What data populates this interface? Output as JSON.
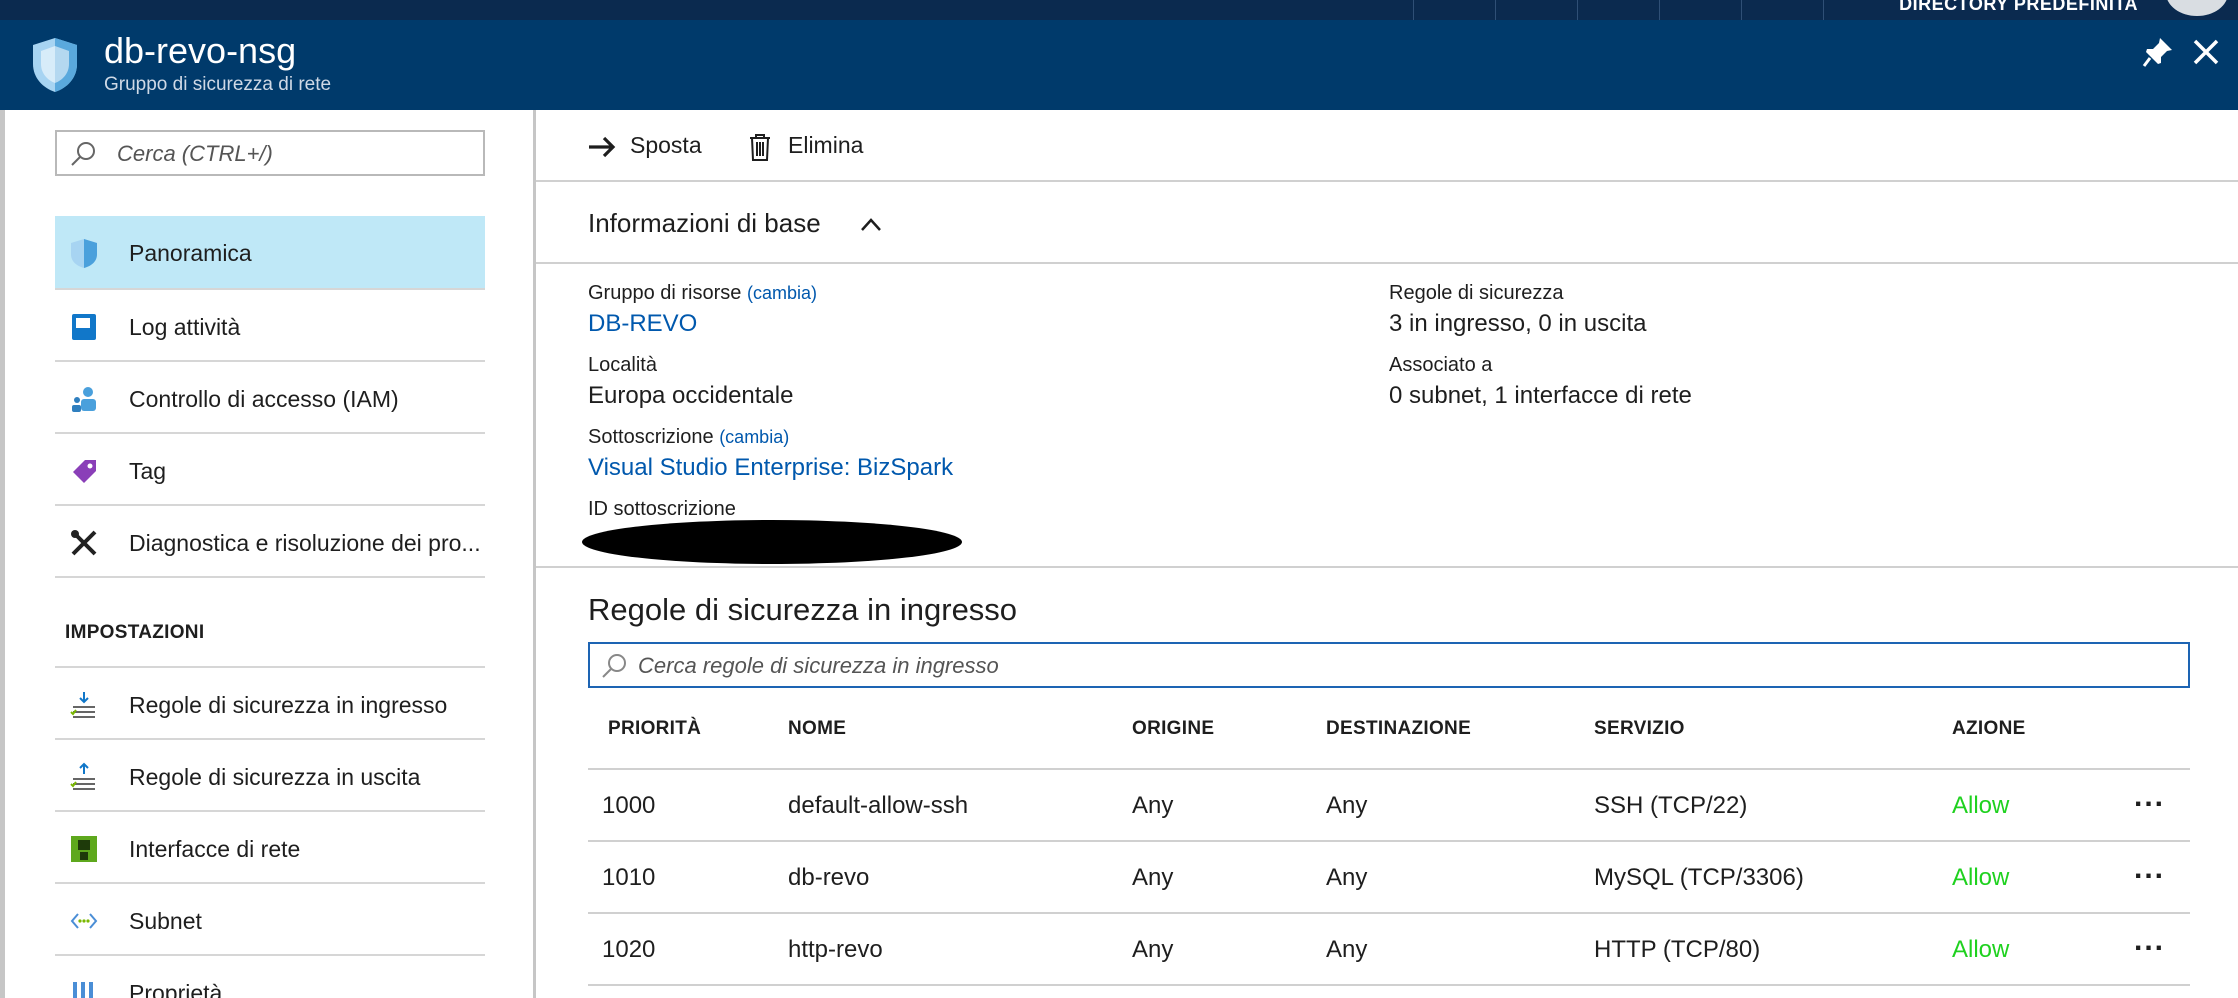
{
  "top_bar": {
    "directory_label": "DIRECTORY PREDEFINITA"
  },
  "header": {
    "title": "db-revo-nsg",
    "subtitle": "Gruppo di sicurezza di rete"
  },
  "sidebar": {
    "search_placeholder": "Cerca (CTRL+/)",
    "items": [
      {
        "label": "Panoramica",
        "icon": "shield-icon",
        "active": true
      },
      {
        "label": "Log attività",
        "icon": "log-icon"
      },
      {
        "label": "Controllo di accesso (IAM)",
        "icon": "users-icon"
      },
      {
        "label": "Tag",
        "icon": "tag-icon"
      },
      {
        "label": "Diagnostica e risoluzione dei pro...",
        "icon": "wrench-icon"
      }
    ],
    "section_heading": "IMPOSTAZIONI",
    "settings_items": [
      {
        "label": "Regole di sicurezza in ingresso",
        "icon": "inbound-rules-icon"
      },
      {
        "label": "Regole di sicurezza in uscita",
        "icon": "outbound-rules-icon"
      },
      {
        "label": "Interfacce di rete",
        "icon": "network-interface-icon"
      },
      {
        "label": "Subnet",
        "icon": "subnet-icon"
      },
      {
        "label": "Proprietà",
        "icon": "properties-icon"
      }
    ]
  },
  "toolbar": {
    "move_label": "Sposta",
    "delete_label": "Elimina"
  },
  "essentials": {
    "heading": "Informazioni di base",
    "resource_group_label": "Gruppo di risorse",
    "change_link": "(cambia)",
    "resource_group_value": "DB-REVO",
    "location_label": "Località",
    "location_value": "Europa occidentale",
    "subscription_label": "Sottoscrizione",
    "subscription_value": "Visual Studio Enterprise: BizSpark",
    "subscription_id_label": "ID sottoscrizione",
    "security_rules_label": "Regole di sicurezza",
    "security_rules_value": "3 in ingresso, 0 in uscita",
    "associated_label": "Associato a",
    "associated_value": "0 subnet, 1 interfacce di rete"
  },
  "inbound": {
    "title": "Regole di sicurezza in ingresso",
    "search_placeholder": "Cerca regole di sicurezza in ingresso",
    "columns": [
      "PRIORITÀ",
      "NOME",
      "ORIGINE",
      "DESTINAZIONE",
      "SERVIZIO",
      "AZIONE"
    ],
    "rows": [
      {
        "priority": "1000",
        "name": "default-allow-ssh",
        "source": "Any",
        "destination": "Any",
        "service": "SSH (TCP/22)",
        "action": "Allow",
        "more": "..."
      },
      {
        "priority": "1010",
        "name": "db-revo",
        "source": "Any",
        "destination": "Any",
        "service": "MySQL (TCP/3306)",
        "action": "Allow",
        "more": "..."
      },
      {
        "priority": "1020",
        "name": "http-revo",
        "source": "Any",
        "destination": "Any",
        "service": "HTTP (TCP/80)",
        "action": "Allow",
        "more": "..."
      }
    ]
  },
  "colors": {
    "header_bg": "#003a6b",
    "active_nav_bg": "#bfe8f7",
    "link": "#0058ad",
    "allow": "#1fd11f"
  }
}
